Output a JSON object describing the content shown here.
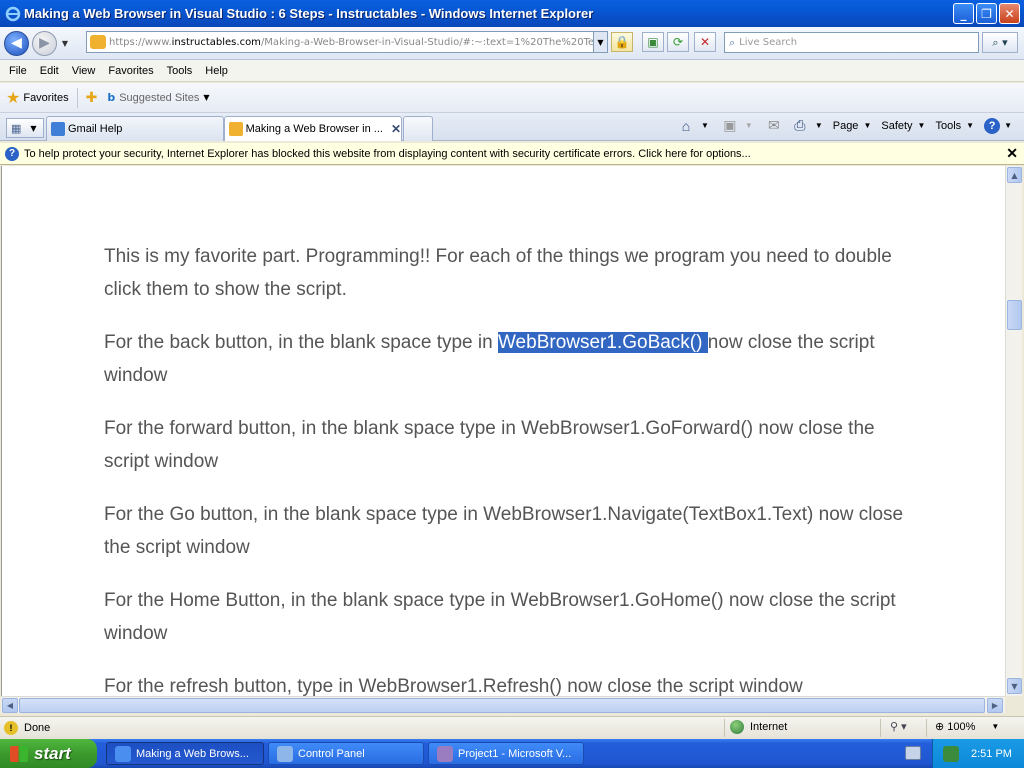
{
  "window": {
    "title": "Making a Web Browser in Visual Studio : 6 Steps - Instructables - Windows Internet Explorer",
    "min": "_",
    "max": "❐",
    "close": "✕"
  },
  "address": {
    "url_prefix": "https://www.",
    "url_domain": "instructables.com",
    "url_rest": "/Making-a-Web-Browser-in-Visual-Studio/#:~:text=1%20The%20Te",
    "search_placeholder": "Live Search"
  },
  "menu": [
    "File",
    "Edit",
    "View",
    "Favorites",
    "Tools",
    "Help"
  ],
  "favorites": {
    "label": "Favorites",
    "suggested": "Suggested Sites"
  },
  "tabs": [
    {
      "label": "Gmail Help"
    },
    {
      "label": "Making a Web Browser in ..."
    }
  ],
  "commandbar": {
    "page": "Page",
    "safety": "Safety",
    "tools": "Tools"
  },
  "infobar": {
    "message": "To help protect your security, Internet Explorer has blocked this website from displaying content with security certificate errors. Click here for options..."
  },
  "content": {
    "p1": "This is my favorite part. Programming!! For each of the things we program you need to double click them to show the script.",
    "p2_before": "For the back button, in the blank space type in ",
    "p2_highlight": "WebBrowser1.GoBack() ",
    "p2_after": "now close the script window",
    "p3": "For the forward button, in the blank space type in WebBrowser1.GoForward() now close the script window",
    "p4": "For the Go button, in the blank space type in WebBrowser1.Navigate(TextBox1.Text) now close the script window",
    "p5": "For the Home Button, in the blank space type in WebBrowser1.GoHome() now close the script window",
    "p6": "For the refresh button, type in WebBrowser1.Refresh() now close the script window"
  },
  "status": {
    "text": "Done",
    "zone": "Internet",
    "zoom": "100%"
  },
  "taskbar": {
    "start": "start",
    "items": [
      {
        "label": "Making a Web Brows..."
      },
      {
        "label": "Control Panel"
      },
      {
        "label": "Project1 - Microsoft V..."
      }
    ],
    "clock": "2:51 PM"
  },
  "colors": {
    "selection": "#3166c2",
    "body_text": "#555555",
    "infobar_bg": "#ffffe1"
  }
}
